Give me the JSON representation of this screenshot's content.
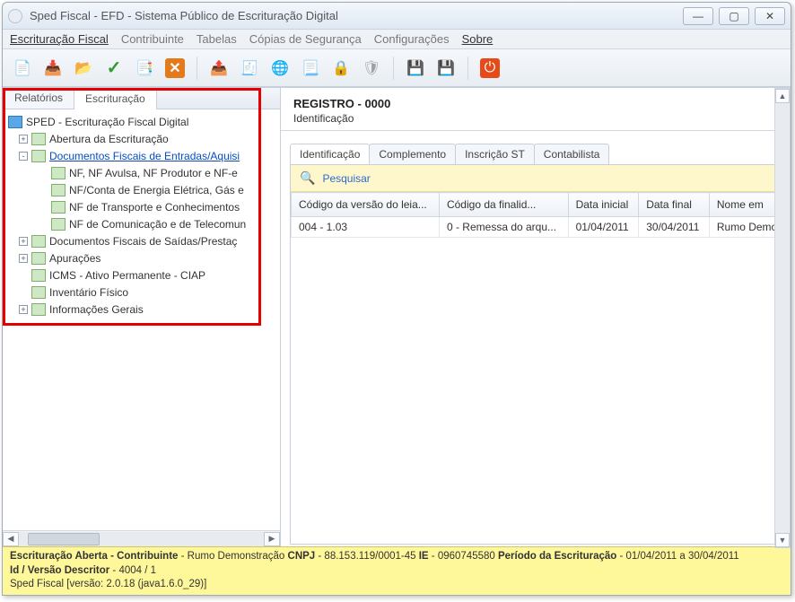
{
  "window": {
    "title": "Sped Fiscal - EFD - Sistema Público de Escrituração Digital"
  },
  "menu": {
    "items": [
      "Escrituração Fiscal",
      "Contribuinte",
      "Tabelas",
      "Cópias de Segurança",
      "Configurações",
      "Sobre"
    ],
    "active_index": 0
  },
  "left_tabs": {
    "items": [
      "Relatórios",
      "Escrituração"
    ],
    "active": 1
  },
  "tree": {
    "root": "SPED - Escrituração Fiscal Digital",
    "nodes": [
      {
        "label": "Abertura da Escrituração",
        "expandable": true,
        "expanded": false
      },
      {
        "label": "Documentos Fiscais de Entradas/Aquisi",
        "expandable": true,
        "expanded": true,
        "selected": true,
        "children": [
          {
            "label": "NF, NF Avulsa, NF Produtor e NF-e"
          },
          {
            "label": "NF/Conta de Energia Elétrica, Gás e"
          },
          {
            "label": "NF de Transporte e Conhecimentos"
          },
          {
            "label": "NF de Comunicação e de Telecomun"
          }
        ]
      },
      {
        "label": "Documentos Fiscais de Saídas/Prestaç",
        "expandable": true,
        "expanded": false
      },
      {
        "label": "Apurações",
        "expandable": true,
        "expanded": false
      },
      {
        "label": "ICMS - Ativo Permanente - CIAP",
        "expandable": false
      },
      {
        "label": "Inventário Físico",
        "expandable": false
      },
      {
        "label": "Informações Gerais",
        "expandable": true,
        "expanded": false
      }
    ]
  },
  "register": {
    "title": "REGISTRO - 0000",
    "subtitle": "Identificação"
  },
  "detail_tabs": {
    "items": [
      "Identificação",
      "Complemento",
      "Inscrição ST",
      "Contabilista"
    ],
    "active": 0
  },
  "search": {
    "label": "Pesquisar"
  },
  "grid": {
    "columns": [
      "Código da versão do leia...",
      "Código da finalid...",
      "Data inicial",
      "Data final",
      "Nome em"
    ],
    "rows": [
      [
        "004 - 1.03",
        "0 - Remessa do arqu...",
        "01/04/2011",
        "30/04/2011",
        "Rumo Demo"
      ]
    ]
  },
  "status": {
    "line1_parts": {
      "a": "Escrituração Aberta - Contribuinte",
      "a_val": " - Rumo Demonstração ",
      "b": "CNPJ",
      "b_val": " - 88.153.119/0001-45 ",
      "c": "IE",
      "c_val": " - 0960745580 ",
      "d": "Período da Escrituração",
      "d_val": " - 01/04/2011 a 30/04/2011"
    },
    "line2_parts": {
      "a": "Id / Versão Descritor",
      "a_val": " - 4004 / 1"
    },
    "line3": "Sped Fiscal [versão: 2.0.18 (java1.6.0_29)]"
  }
}
